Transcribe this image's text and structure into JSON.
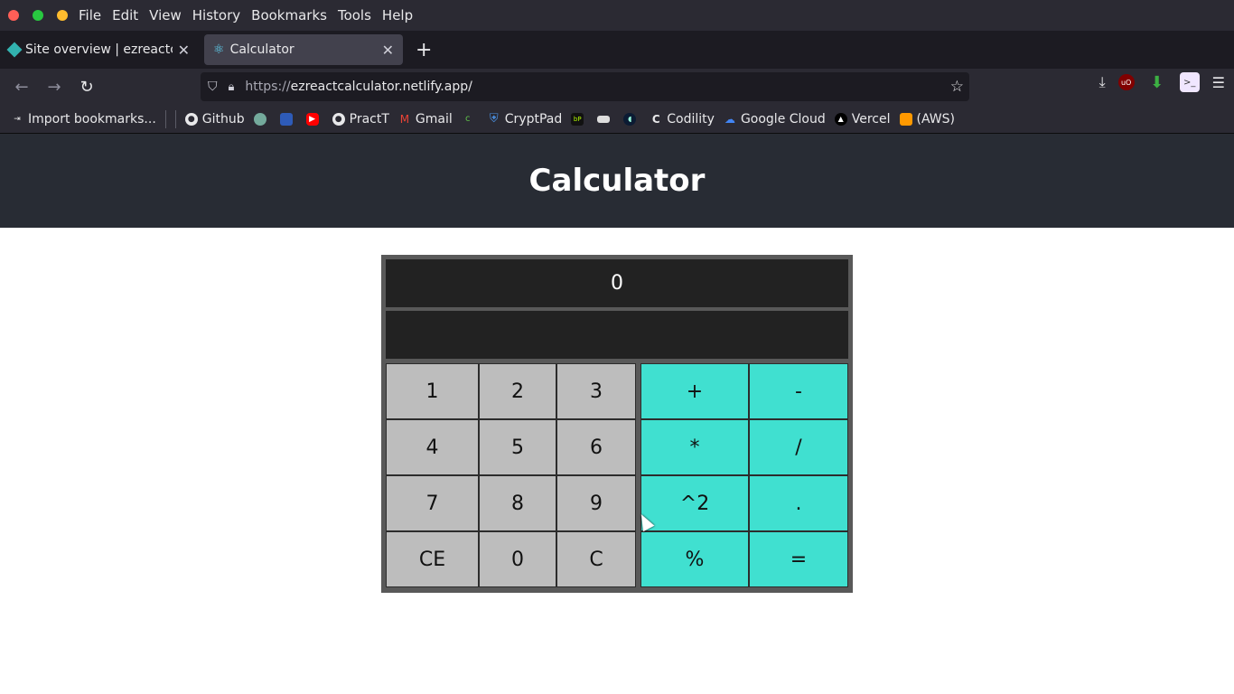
{
  "menubar": {
    "items": [
      {
        "label": "File"
      },
      {
        "label": "Edit"
      },
      {
        "label": "View"
      },
      {
        "label": "History"
      },
      {
        "label": "Bookmarks"
      },
      {
        "label": "Tools"
      },
      {
        "label": "Help"
      }
    ]
  },
  "tabs": [
    {
      "title": "Site overview | ezreactcal",
      "icon": "netlify-icon",
      "active": false
    },
    {
      "title": "Calculator",
      "icon": "react-icon",
      "active": true
    }
  ],
  "urlbar": {
    "prefix": "https://",
    "domain": "ezreactcalculator.netlify.app/"
  },
  "bookmarks": [
    {
      "label": "Import bookmarks...",
      "icon": "import-icon"
    },
    {
      "label": "Github",
      "icon": "github-icon"
    },
    {
      "label": "",
      "icon": "openai-icon"
    },
    {
      "label": "",
      "icon": "app-icon"
    },
    {
      "label": "",
      "icon": "youtube-icon"
    },
    {
      "label": "PractT",
      "icon": "github-icon"
    },
    {
      "label": "Gmail",
      "icon": "gmail-icon"
    },
    {
      "label": "",
      "icon": "leaf-icon"
    },
    {
      "label": "CryptPad",
      "icon": "cryptpad-icon"
    },
    {
      "label": "",
      "icon": "bp-icon"
    },
    {
      "label": "",
      "icon": "bar-icon"
    },
    {
      "label": "",
      "icon": "circle-icon"
    },
    {
      "label": "Codility",
      "icon": "codility-icon"
    },
    {
      "label": "Google Cloud",
      "icon": "google-cloud-icon"
    },
    {
      "label": "Vercel",
      "icon": "vercel-icon"
    },
    {
      "label": "(AWS)",
      "icon": "aws-icon"
    }
  ],
  "page": {
    "title": "Calculator"
  },
  "calculator": {
    "display_main": "0",
    "display_secondary": "",
    "number_keys": [
      "1",
      "2",
      "3",
      "4",
      "5",
      "6",
      "7",
      "8",
      "9",
      "CE",
      "0",
      "C"
    ],
    "operator_keys": [
      "+",
      "-",
      "*",
      "/",
      "^2",
      ".",
      "%",
      "="
    ]
  },
  "colors": {
    "header_bg": "#282c34",
    "number_key_bg": "#bdbdbd",
    "operator_key_bg": "#40e0d0",
    "display_bg": "#222222"
  }
}
